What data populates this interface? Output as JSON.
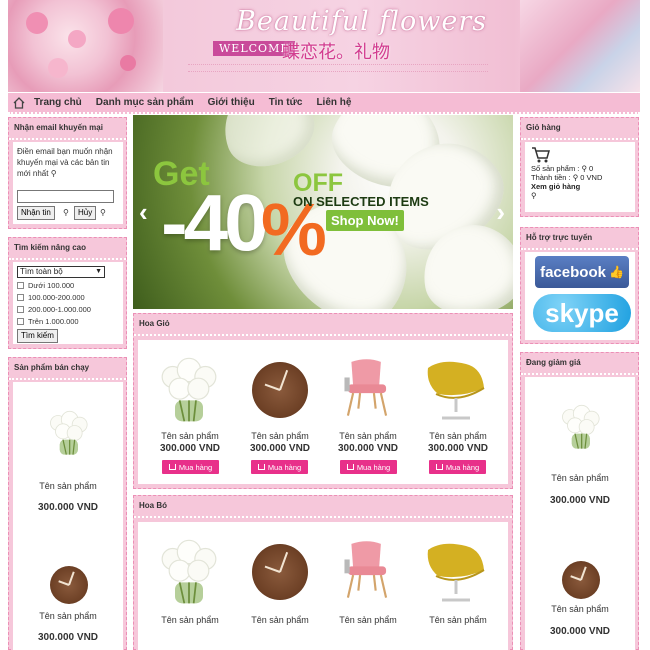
{
  "banner": {
    "title": "Beautiful flowers",
    "welcome": "WELCOME",
    "tagline": "蝶恋花。礼物"
  },
  "nav": {
    "items": [
      "Trang chủ",
      "Danh mục sản phẩm",
      "Giới thiệu",
      "Tin tức",
      "Liên hệ"
    ]
  },
  "newsletter": {
    "title": "Nhận email khuyến mại",
    "text": "Điền email bạn muốn nhận khuyến mại và các bản tin mới nhất",
    "email_value": "",
    "subscribe_label": "Nhận tin",
    "cancel_label": "Hủy"
  },
  "advanced_search": {
    "title": "Tìm kiếm nâng cao",
    "select_value": "Tìm toàn bộ",
    "options": [
      "Dưới 100.000",
      "100.000-200.000",
      "200.000-1.000.000",
      "Trên 1.000.000"
    ],
    "search_label": "Tìm kiếm"
  },
  "bestsellers": {
    "title": "Sản phẩm bán chạy",
    "items": [
      {
        "name": "Tên sản phẩm",
        "price": "300.000 VND",
        "image": "white-flowers"
      },
      {
        "name": "Tên sản phẩm",
        "price": "300.000 VND",
        "image": "wooden-clock"
      }
    ]
  },
  "slider": {
    "get": "Get",
    "discount": "-40",
    "percent": "%",
    "off": "OFF",
    "on_selected": "ON SELECTED ITEMS",
    "shop_now": "Shop Now!"
  },
  "section_hoa_gio": {
    "title": "Hoa Giỏ",
    "products": [
      {
        "name": "Tên sản phẩm",
        "price": "300.000 VND",
        "buy": "Mua hàng",
        "image": "white-flowers"
      },
      {
        "name": "Tên sản phẩm",
        "price": "300.000 VND",
        "buy": "Mua hàng",
        "image": "wooden-clock"
      },
      {
        "name": "Tên sản phẩm",
        "price": "300.000 VND",
        "buy": "Mua hàng",
        "image": "pink-chair"
      },
      {
        "name": "Tên sản phẩm",
        "price": "300.000 VND",
        "buy": "Mua hàng",
        "image": "yellow-chair"
      }
    ]
  },
  "section_hoa_bo": {
    "title": "Hoa Bó",
    "products": [
      {
        "name": "Tên sản phẩm",
        "image": "white-flowers"
      },
      {
        "name": "Tên sản phẩm",
        "image": "wooden-clock"
      },
      {
        "name": "Tên sản phẩm",
        "image": "pink-chair"
      },
      {
        "name": "Tên sản phẩm",
        "image": "yellow-chair"
      }
    ]
  },
  "cart": {
    "title": "Giỏ hàng",
    "count_label": "Số sản phẩm : ",
    "count_value": "0",
    "total_label": "Thành tiền : ",
    "total_value": "0 VND",
    "view_cart": "Xem giỏ hàng"
  },
  "support": {
    "title": "Hỗ trợ trực tuyến",
    "facebook": "facebook",
    "skype": "skype"
  },
  "discount": {
    "title": "Đang giảm giá",
    "items": [
      {
        "name": "Tên sản phẩm",
        "price": "300.000 VND",
        "image": "white-flowers"
      },
      {
        "name": "Tên sản phẩm",
        "price": "300.000 VND",
        "image": "wooden-clock"
      }
    ]
  },
  "colors": {
    "accent": "#e8308a",
    "panel_bg": "#f6c7da",
    "nav_bg": "#f5bcd4"
  }
}
